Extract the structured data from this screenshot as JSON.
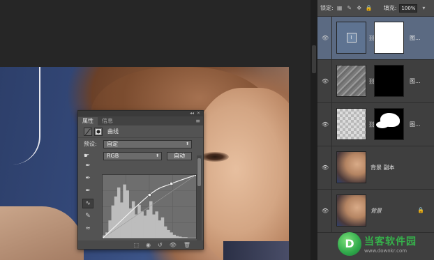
{
  "properties_panel": {
    "collapse_glyph": "◂◂",
    "close_glyph": "✕",
    "tabs": [
      {
        "label": "属性",
        "active": true
      },
      {
        "label": "信息",
        "active": false
      }
    ],
    "menu_glyph": "≡",
    "adjustment_icons": [
      "curves-adjustment-icon",
      "layer-mask-icon"
    ],
    "adjustment_name": "曲线",
    "preset_label": "预设:",
    "preset_value": "自定",
    "channel_value": "RGB",
    "auto_button": "自动",
    "bottom_icons": [
      "clip-to-layer-icon",
      "view-previous-icon",
      "reset-icon",
      "visibility-icon",
      "delete-icon"
    ]
  },
  "curves_chart": {
    "type": "curve-with-histogram",
    "control_points": [
      [
        0,
        0
      ],
      [
        128,
        175
      ],
      [
        188,
        220
      ],
      [
        255,
        255
      ]
    ],
    "histogram": [
      5,
      10,
      30,
      55,
      70,
      85,
      60,
      90,
      80,
      50,
      62,
      40,
      56,
      45,
      38,
      48,
      62,
      40,
      45,
      30,
      35,
      20,
      14,
      10,
      6,
      4,
      3,
      2,
      2,
      1,
      1,
      1
    ],
    "colors": {
      "histogram": "#bdbdbd",
      "curve": "#f2f2f2",
      "background": "#6e6e6e"
    }
  },
  "layers_panel": {
    "lock_label": "锁定:",
    "lock_icons": [
      "lock-transparent-icon",
      "lock-paint-icon",
      "lock-move-icon",
      "lock-all-icon"
    ],
    "fill_label": "填充:",
    "fill_value": "100%",
    "layers": [
      {
        "thumb": "curves",
        "mask": "white",
        "name": "图...",
        "selected": true
      },
      {
        "thumb": "texture",
        "mask": "black",
        "name": "图...",
        "selected": false
      },
      {
        "thumb": "checker",
        "mask": "blob",
        "name": "图...",
        "selected": false
      },
      {
        "thumb": "photo",
        "mask": null,
        "name": "背景 副本",
        "selected": false
      },
      {
        "thumb": "photo",
        "mask": null,
        "name": "背景",
        "selected": false,
        "locked": true
      }
    ]
  },
  "watermark": {
    "logo_glyph": "D",
    "brand": "当客软件园",
    "url": "www.downkr.com"
  }
}
